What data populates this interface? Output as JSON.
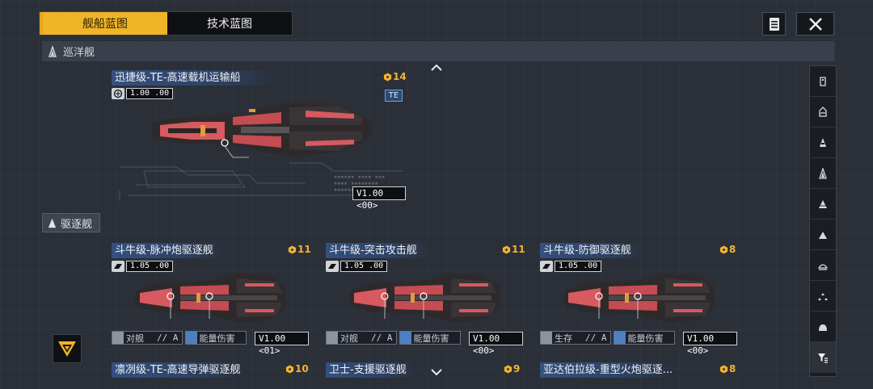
{
  "tabs": [
    {
      "label": "舰船蓝图",
      "active": true
    },
    {
      "label": "技术蓝图",
      "active": false
    }
  ],
  "sections": {
    "cruiser": "巡洋舰",
    "destroyer": "驱逐舰"
  },
  "featured": {
    "title": "迅捷级-TE-高速载机运输船",
    "cost": "14",
    "version": "1.00 .00",
    "badge": "TE",
    "ver_tag": "V1.00 <00>"
  },
  "cards": [
    {
      "title": "斗牛级-脉冲炮驱逐舰",
      "cost": "11",
      "version": "1.05 .00",
      "tag1": "对舰",
      "tag1_extra": "// A",
      "tag2": "能量伤害",
      "ver_tag": "V1.00 <01>"
    },
    {
      "title": "斗牛级-突击攻击舰",
      "cost": "11",
      "version": "1.05 .00",
      "tag1": "对舰",
      "tag1_extra": "// A",
      "tag2": "能量伤害",
      "ver_tag": "V1.00 <00>"
    },
    {
      "title": "斗牛级-防御驱逐舰",
      "cost": "8",
      "version": "1.05 .00",
      "tag1": "生存",
      "tag1_extra": "// A",
      "tag2": "能量伤害",
      "ver_tag": "V1.00 <00>"
    }
  ],
  "bottom_cards": [
    {
      "title": "凛冽级-TE-高速导弹驱逐舰",
      "cost": "10"
    },
    {
      "title": "卫士-支援驱逐舰",
      "cost": "9"
    },
    {
      "title": "亚达伯拉级-重型火炮驱逐...",
      "cost": "8"
    }
  ],
  "icons": {
    "menu": "document-icon",
    "close": "close-icon",
    "filter": "filter-icon",
    "cost": "hex-currency-icon"
  },
  "colors": {
    "accent": "#f0b429",
    "title_bg": "#34507e",
    "ship_red": "#d65a5f"
  }
}
